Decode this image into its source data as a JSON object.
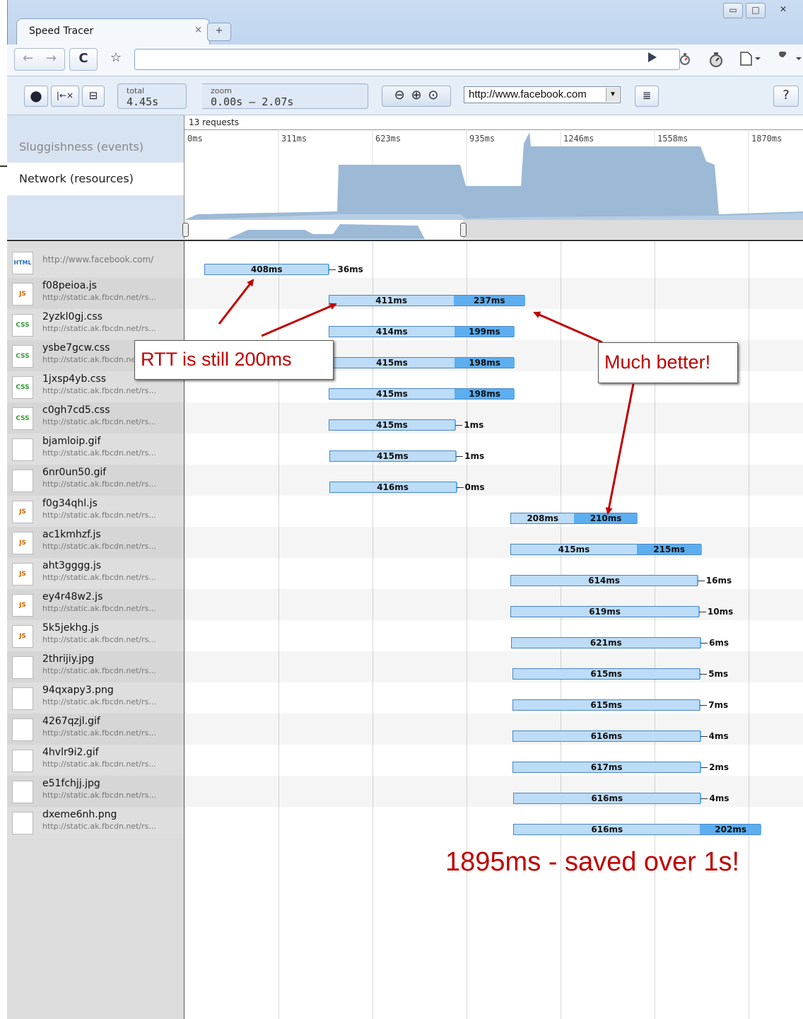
{
  "window": {
    "tab_title": "Speed Tracer",
    "tab_close": "×",
    "new_tab": "+",
    "minimize": "▭",
    "maximize": "□",
    "close": "✕"
  },
  "navbar": {
    "back": "←",
    "forward": "→",
    "reload": "C",
    "star": "☆",
    "url": "",
    "icons": [
      "play-icon",
      "speedtracer-icon",
      "stopwatch-icon",
      "page-menu-icon",
      "wrench-menu-icon"
    ]
  },
  "toolbar": {
    "record": "●",
    "clear": "|←×",
    "save": "⊟",
    "total_label": "total",
    "total_value": "4.45s",
    "zoom_label": "zoom",
    "zoom_value": "0.00s – 2.07s",
    "zoom_out": "⊖",
    "zoom_in": "⊕",
    "zoom_all": "⊙",
    "page_url": "http://www.facebook.com",
    "page_url_arrow": "▼",
    "report": "≣",
    "help": "?"
  },
  "overview": {
    "rows": [
      "Sluggishness (events)",
      "Network (resources)"
    ],
    "request_count": "13 requests",
    "ticks": [
      "0ms",
      "311ms",
      "623ms",
      "935ms",
      "1246ms",
      "1558ms",
      "1870ms"
    ]
  },
  "resources": [
    {
      "name": "",
      "url": "http://www.facebook.com/",
      "type": "html",
      "start": 0,
      "a": 408,
      "b": 36,
      "b_style": "tail",
      "a_label": "408ms",
      "b_label": "36ms"
    },
    {
      "name": "f08peioa.js",
      "url": "http://static.ak.fbcdn.net/rs...",
      "type": "js",
      "start": 411,
      "a": 411,
      "b": 237,
      "b_style": "bar",
      "a_label": "411ms",
      "b_label": "237ms"
    },
    {
      "name": "2yzkl0gj.css",
      "url": "http://static.ak.fbcdn.net/rs...",
      "type": "css",
      "start": 411,
      "a": 414,
      "b": 199,
      "b_style": "bar",
      "a_label": "414ms",
      "b_label": "199ms"
    },
    {
      "name": "ysbe7gcw.css",
      "url": "http://static.ak.fbcdn.net/rs...",
      "type": "css",
      "start": 411,
      "a": 415,
      "b": 198,
      "b_style": "bar",
      "a_label": "415ms",
      "b_label": "198ms"
    },
    {
      "name": "1jxsp4yb.css",
      "url": "http://static.ak.fbcdn.net/rs...",
      "type": "css",
      "start": 411,
      "a": 415,
      "b": 198,
      "b_style": "bar",
      "a_label": "415ms",
      "b_label": "198ms"
    },
    {
      "name": "c0gh7cd5.css",
      "url": "http://static.ak.fbcdn.net/rs...",
      "type": "css",
      "start": 411,
      "a": 415,
      "b": 1,
      "b_style": "tail",
      "a_label": "415ms",
      "b_label": "1ms"
    },
    {
      "name": "bjamloip.gif",
      "url": "http://static.ak.fbcdn.net/rs...",
      "type": "img",
      "start": 413,
      "a": 415,
      "b": 1,
      "b_style": "tail",
      "a_label": "415ms",
      "b_label": "1ms"
    },
    {
      "name": "6nr0un50.gif",
      "url": "http://static.ak.fbcdn.net/rs...",
      "type": "img",
      "start": 413,
      "a": 416,
      "b": 0,
      "b_style": "tail",
      "a_label": "416ms",
      "b_label": "0ms"
    },
    {
      "name": "f0g34qhl.js",
      "url": "http://static.ak.fbcdn.net/rs...",
      "type": "js",
      "start": 1013,
      "a": 208,
      "b": 210,
      "b_style": "bar",
      "a_label": "208ms",
      "b_label": "210ms"
    },
    {
      "name": "ac1kmhzf.js",
      "url": "http://static.ak.fbcdn.net/rs...",
      "type": "js",
      "start": 1013,
      "a": 415,
      "b": 215,
      "b_style": "bar",
      "a_label": "415ms",
      "b_label": "215ms"
    },
    {
      "name": "aht3gggg.js",
      "url": "http://static.ak.fbcdn.net/rs...",
      "type": "js",
      "start": 1013,
      "a": 614,
      "b": 16,
      "b_style": "tail",
      "a_label": "614ms",
      "b_label": "16ms"
    },
    {
      "name": "ey4r48w2.js",
      "url": "http://static.ak.fbcdn.net/rs...",
      "type": "js",
      "start": 1013,
      "a": 619,
      "b": 10,
      "b_style": "tail",
      "a_label": "619ms",
      "b_label": "10ms"
    },
    {
      "name": "5k5jekhg.js",
      "url": "http://static.ak.fbcdn.net/rs...",
      "type": "js",
      "start": 1016,
      "a": 621,
      "b": 6,
      "b_style": "tail",
      "a_label": "621ms",
      "b_label": "6ms"
    },
    {
      "name": "2thrijiy.jpg",
      "url": "http://static.ak.fbcdn.net/rs...",
      "type": "img",
      "start": 1020,
      "a": 615,
      "b": 5,
      "b_style": "tail",
      "a_label": "615ms",
      "b_label": "5ms"
    },
    {
      "name": "94qxapy3.png",
      "url": "http://static.ak.fbcdn.net/rs...",
      "type": "img",
      "start": 1020,
      "a": 615,
      "b": 7,
      "b_style": "tail",
      "a_label": "615ms",
      "b_label": "7ms"
    },
    {
      "name": "4267qzjl.gif",
      "url": "http://static.ak.fbcdn.net/rs...",
      "type": "img",
      "start": 1020,
      "a": 616,
      "b": 4,
      "b_style": "tail",
      "a_label": "616ms",
      "b_label": "4ms"
    },
    {
      "name": "4hvlr9i2.gif",
      "url": "http://static.ak.fbcdn.net/rs...",
      "type": "img",
      "start": 1020,
      "a": 617,
      "b": 2,
      "b_style": "tail",
      "a_label": "617ms",
      "b_label": "2ms"
    },
    {
      "name": "e51fchjj.jpg",
      "url": "http://static.ak.fbcdn.net/rs...",
      "type": "img",
      "start": 1022,
      "a": 616,
      "b": 4,
      "b_style": "tail",
      "a_label": "616ms",
      "b_label": "4ms"
    },
    {
      "name": "dxeme6nh.png",
      "url": "http://static.ak.fbcdn.net/rs...",
      "type": "img",
      "start": 1022,
      "a": 616,
      "b": 202,
      "b_style": "bar",
      "a_label": "616ms",
      "b_label": "202ms"
    }
  ],
  "annotations": {
    "rtt_note": "RTT is still 200ms",
    "better_note": "Much better!",
    "summary": "1895ms - saved over 1s!"
  },
  "colors": {
    "bar_light": "#bcdcf7",
    "bar_dark": "#5daeef",
    "annotation": "#c00000"
  }
}
